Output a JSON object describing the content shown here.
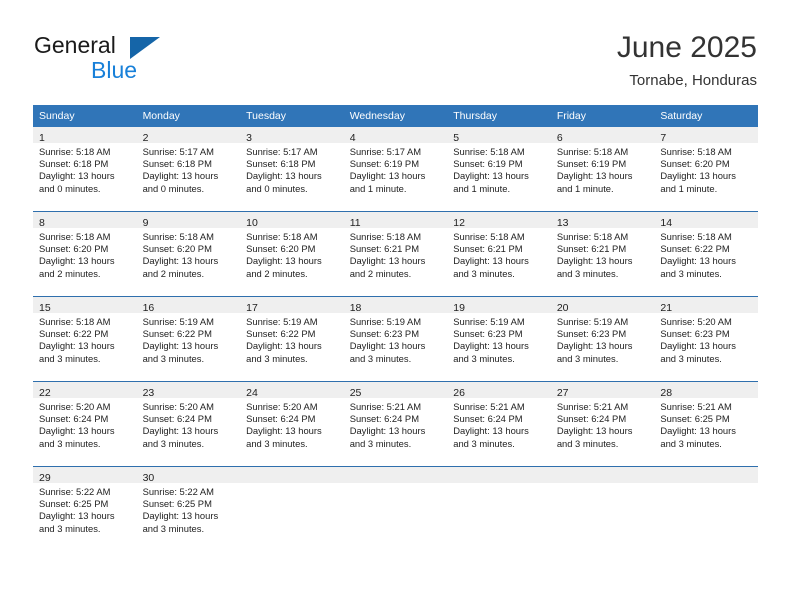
{
  "brand": {
    "name_top": "General",
    "name_bottom": "Blue",
    "triangle_color": "#1565a8",
    "blue_color": "#1880d9"
  },
  "header": {
    "title": "June 2025",
    "subtitle": "Tornabe, Honduras",
    "header_bg": "#3075b8",
    "day_band_bg": "#efefef",
    "row_divider": "#2f6fad"
  },
  "weekdays": [
    "Sunday",
    "Monday",
    "Tuesday",
    "Wednesday",
    "Thursday",
    "Friday",
    "Saturday"
  ],
  "weeks": [
    [
      {
        "day": "1",
        "sunrise": "Sunrise: 5:18 AM",
        "sunset": "Sunset: 6:18 PM",
        "daylight_1": "Daylight: 13 hours",
        "daylight_2": "and 0 minutes."
      },
      {
        "day": "2",
        "sunrise": "Sunrise: 5:17 AM",
        "sunset": "Sunset: 6:18 PM",
        "daylight_1": "Daylight: 13 hours",
        "daylight_2": "and 0 minutes."
      },
      {
        "day": "3",
        "sunrise": "Sunrise: 5:17 AM",
        "sunset": "Sunset: 6:18 PM",
        "daylight_1": "Daylight: 13 hours",
        "daylight_2": "and 0 minutes."
      },
      {
        "day": "4",
        "sunrise": "Sunrise: 5:17 AM",
        "sunset": "Sunset: 6:19 PM",
        "daylight_1": "Daylight: 13 hours",
        "daylight_2": "and 1 minute."
      },
      {
        "day": "5",
        "sunrise": "Sunrise: 5:18 AM",
        "sunset": "Sunset: 6:19 PM",
        "daylight_1": "Daylight: 13 hours",
        "daylight_2": "and 1 minute."
      },
      {
        "day": "6",
        "sunrise": "Sunrise: 5:18 AM",
        "sunset": "Sunset: 6:19 PM",
        "daylight_1": "Daylight: 13 hours",
        "daylight_2": "and 1 minute."
      },
      {
        "day": "7",
        "sunrise": "Sunrise: 5:18 AM",
        "sunset": "Sunset: 6:20 PM",
        "daylight_1": "Daylight: 13 hours",
        "daylight_2": "and 1 minute."
      }
    ],
    [
      {
        "day": "8",
        "sunrise": "Sunrise: 5:18 AM",
        "sunset": "Sunset: 6:20 PM",
        "daylight_1": "Daylight: 13 hours",
        "daylight_2": "and 2 minutes."
      },
      {
        "day": "9",
        "sunrise": "Sunrise: 5:18 AM",
        "sunset": "Sunset: 6:20 PM",
        "daylight_1": "Daylight: 13 hours",
        "daylight_2": "and 2 minutes."
      },
      {
        "day": "10",
        "sunrise": "Sunrise: 5:18 AM",
        "sunset": "Sunset: 6:20 PM",
        "daylight_1": "Daylight: 13 hours",
        "daylight_2": "and 2 minutes."
      },
      {
        "day": "11",
        "sunrise": "Sunrise: 5:18 AM",
        "sunset": "Sunset: 6:21 PM",
        "daylight_1": "Daylight: 13 hours",
        "daylight_2": "and 2 minutes."
      },
      {
        "day": "12",
        "sunrise": "Sunrise: 5:18 AM",
        "sunset": "Sunset: 6:21 PM",
        "daylight_1": "Daylight: 13 hours",
        "daylight_2": "and 3 minutes."
      },
      {
        "day": "13",
        "sunrise": "Sunrise: 5:18 AM",
        "sunset": "Sunset: 6:21 PM",
        "daylight_1": "Daylight: 13 hours",
        "daylight_2": "and 3 minutes."
      },
      {
        "day": "14",
        "sunrise": "Sunrise: 5:18 AM",
        "sunset": "Sunset: 6:22 PM",
        "daylight_1": "Daylight: 13 hours",
        "daylight_2": "and 3 minutes."
      }
    ],
    [
      {
        "day": "15",
        "sunrise": "Sunrise: 5:18 AM",
        "sunset": "Sunset: 6:22 PM",
        "daylight_1": "Daylight: 13 hours",
        "daylight_2": "and 3 minutes."
      },
      {
        "day": "16",
        "sunrise": "Sunrise: 5:19 AM",
        "sunset": "Sunset: 6:22 PM",
        "daylight_1": "Daylight: 13 hours",
        "daylight_2": "and 3 minutes."
      },
      {
        "day": "17",
        "sunrise": "Sunrise: 5:19 AM",
        "sunset": "Sunset: 6:22 PM",
        "daylight_1": "Daylight: 13 hours",
        "daylight_2": "and 3 minutes."
      },
      {
        "day": "18",
        "sunrise": "Sunrise: 5:19 AM",
        "sunset": "Sunset: 6:23 PM",
        "daylight_1": "Daylight: 13 hours",
        "daylight_2": "and 3 minutes."
      },
      {
        "day": "19",
        "sunrise": "Sunrise: 5:19 AM",
        "sunset": "Sunset: 6:23 PM",
        "daylight_1": "Daylight: 13 hours",
        "daylight_2": "and 3 minutes."
      },
      {
        "day": "20",
        "sunrise": "Sunrise: 5:19 AM",
        "sunset": "Sunset: 6:23 PM",
        "daylight_1": "Daylight: 13 hours",
        "daylight_2": "and 3 minutes."
      },
      {
        "day": "21",
        "sunrise": "Sunrise: 5:20 AM",
        "sunset": "Sunset: 6:23 PM",
        "daylight_1": "Daylight: 13 hours",
        "daylight_2": "and 3 minutes."
      }
    ],
    [
      {
        "day": "22",
        "sunrise": "Sunrise: 5:20 AM",
        "sunset": "Sunset: 6:24 PM",
        "daylight_1": "Daylight: 13 hours",
        "daylight_2": "and 3 minutes."
      },
      {
        "day": "23",
        "sunrise": "Sunrise: 5:20 AM",
        "sunset": "Sunset: 6:24 PM",
        "daylight_1": "Daylight: 13 hours",
        "daylight_2": "and 3 minutes."
      },
      {
        "day": "24",
        "sunrise": "Sunrise: 5:20 AM",
        "sunset": "Sunset: 6:24 PM",
        "daylight_1": "Daylight: 13 hours",
        "daylight_2": "and 3 minutes."
      },
      {
        "day": "25",
        "sunrise": "Sunrise: 5:21 AM",
        "sunset": "Sunset: 6:24 PM",
        "daylight_1": "Daylight: 13 hours",
        "daylight_2": "and 3 minutes."
      },
      {
        "day": "26",
        "sunrise": "Sunrise: 5:21 AM",
        "sunset": "Sunset: 6:24 PM",
        "daylight_1": "Daylight: 13 hours",
        "daylight_2": "and 3 minutes."
      },
      {
        "day": "27",
        "sunrise": "Sunrise: 5:21 AM",
        "sunset": "Sunset: 6:24 PM",
        "daylight_1": "Daylight: 13 hours",
        "daylight_2": "and 3 minutes."
      },
      {
        "day": "28",
        "sunrise": "Sunrise: 5:21 AM",
        "sunset": "Sunset: 6:25 PM",
        "daylight_1": "Daylight: 13 hours",
        "daylight_2": "and 3 minutes."
      }
    ],
    [
      {
        "day": "29",
        "sunrise": "Sunrise: 5:22 AM",
        "sunset": "Sunset: 6:25 PM",
        "daylight_1": "Daylight: 13 hours",
        "daylight_2": "and 3 minutes."
      },
      {
        "day": "30",
        "sunrise": "Sunrise: 5:22 AM",
        "sunset": "Sunset: 6:25 PM",
        "daylight_1": "Daylight: 13 hours",
        "daylight_2": "and 3 minutes."
      },
      {
        "day": "",
        "sunrise": "",
        "sunset": "",
        "daylight_1": "",
        "daylight_2": ""
      },
      {
        "day": "",
        "sunrise": "",
        "sunset": "",
        "daylight_1": "",
        "daylight_2": ""
      },
      {
        "day": "",
        "sunrise": "",
        "sunset": "",
        "daylight_1": "",
        "daylight_2": ""
      },
      {
        "day": "",
        "sunrise": "",
        "sunset": "",
        "daylight_1": "",
        "daylight_2": ""
      },
      {
        "day": "",
        "sunrise": "",
        "sunset": "",
        "daylight_1": "",
        "daylight_2": ""
      }
    ]
  ]
}
